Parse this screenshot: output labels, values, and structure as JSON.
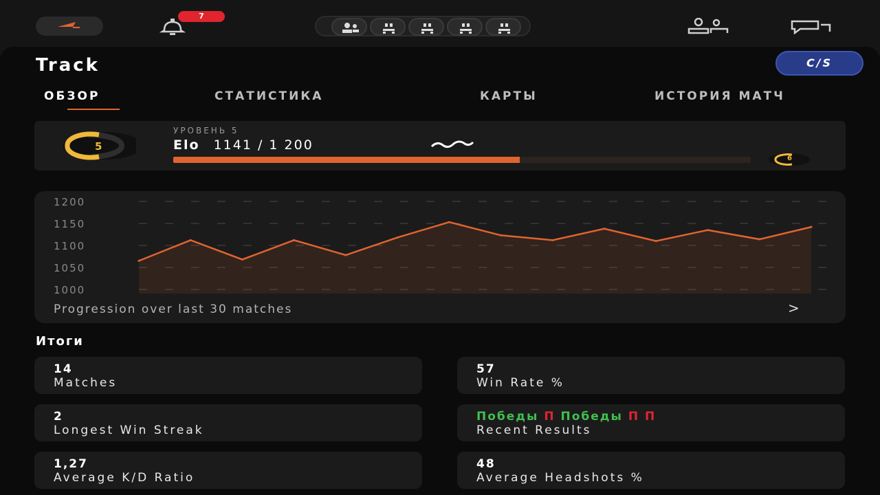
{
  "header": {
    "notification_count": "7",
    "icons": [
      "app-logo-icon",
      "bell-icon",
      "party-slot-icon",
      "friends-icon",
      "chat-icon"
    ],
    "party_slots": 5
  },
  "page": {
    "title": "Track",
    "game_badge": "C∕S"
  },
  "tabs": [
    {
      "label": "ОБЗОР",
      "active": true
    },
    {
      "label": "СТАТИСТИКА",
      "active": false
    },
    {
      "label": "КАРТЫ",
      "active": false
    },
    {
      "label": "ИСТОРИЯ МАТЧ",
      "active": false
    }
  ],
  "level": {
    "level": "5",
    "label": "УРОВЕНЬ 5",
    "elo_label": "Elo",
    "elo_value": "1141 / 1 200",
    "progress_fraction": 0.6,
    "next_level": "6",
    "accent_color": "#e06430",
    "level_color": "#f0b93a"
  },
  "chart_data": {
    "type": "area",
    "title": "",
    "xlabel": "",
    "ylabel": "",
    "ylim": [
      1000,
      1200
    ],
    "yticks": [
      "1200",
      "1150",
      "1100",
      "1050",
      "1000"
    ],
    "grid": true,
    "series": [
      {
        "values": [
          1065,
          1112,
          1068,
          1112,
          1078,
          1118,
          1153,
          1123,
          1112,
          1138,
          1110,
          1135,
          1114,
          1142
        ]
      }
    ],
    "caption": "Progression over last 30 matches",
    "line_color": "#e06430"
  },
  "summary": {
    "title": "Итоги",
    "stats": [
      {
        "value": "14",
        "label": "Matches"
      },
      {
        "value": "57",
        "label": "Win Rate %"
      },
      {
        "value": "2",
        "label": "Longest Win Streak"
      },
      {
        "results": [
          {
            "text": "Победы",
            "type": "win"
          },
          {
            "text": "П",
            "type": "loss"
          },
          {
            "text": "Победы",
            "type": "win"
          },
          {
            "text": "П",
            "type": "loss"
          },
          {
            "text": "П",
            "type": "loss"
          }
        ],
        "label": "Recent Results"
      },
      {
        "value": "1,27",
        "label": "Average K/D Ratio"
      },
      {
        "value": "48",
        "label": "Average Headshots %"
      }
    ]
  }
}
